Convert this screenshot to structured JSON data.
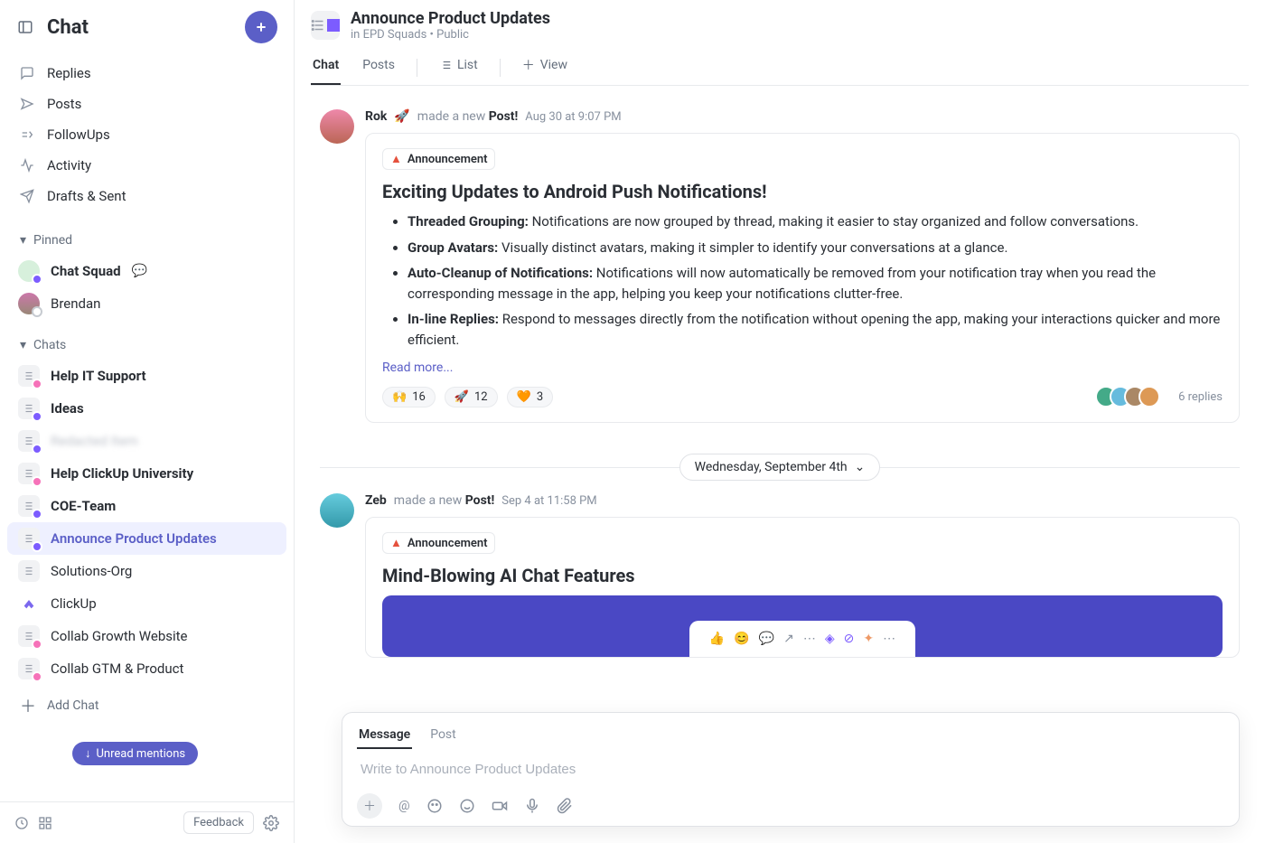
{
  "sidebar": {
    "title": "Chat",
    "nav": [
      {
        "label": "Replies"
      },
      {
        "label": "Posts"
      },
      {
        "label": "FollowUps"
      },
      {
        "label": "Activity"
      },
      {
        "label": "Drafts & Sent"
      }
    ],
    "pinned_header": "Pinned",
    "pinned": [
      {
        "label": "Chat Squad",
        "bold": true,
        "has_bubble": true
      },
      {
        "label": "Brendan"
      }
    ],
    "chats_header": "Chats",
    "chats": [
      {
        "label": "Help IT Support",
        "bold": true,
        "dot": "pink"
      },
      {
        "label": "Ideas",
        "bold": true,
        "dot": "purple"
      },
      {
        "label": "Redacted Item",
        "blur": true,
        "dot": "purple"
      },
      {
        "label": "Help ClickUp University",
        "bold": true,
        "dot": "pink"
      },
      {
        "label": "COE-Team",
        "bold": true,
        "dot": "purple"
      },
      {
        "label": "Announce Product Updates",
        "active": true,
        "dot": "purple"
      },
      {
        "label": "Solutions-Org",
        "dot": ""
      },
      {
        "label": "ClickUp",
        "clickup_logo": true
      },
      {
        "label": "Collab Growth Website",
        "dot": "pink"
      },
      {
        "label": "Collab GTM & Product",
        "dot": "pink"
      }
    ],
    "add_chat": "Add Chat",
    "unread_pill": "Unread mentions",
    "feedback": "Feedback"
  },
  "header": {
    "title": "Announce Product Updates",
    "location_prefix": "in ",
    "location": "EPD Squads",
    "visibility": "Public",
    "tabs": [
      {
        "label": "Chat",
        "active": true
      },
      {
        "label": "Posts"
      },
      {
        "label": "List",
        "icon": "list"
      },
      {
        "label": "View",
        "icon": "plus"
      }
    ]
  },
  "feed": {
    "post1": {
      "author": "Rok",
      "emoji": "🚀",
      "action": "made a new",
      "action_bold": "Post!",
      "timestamp": "Aug 30 at 9:07 PM",
      "badge": "Announcement",
      "title": "Exciting Updates to Android Push Notifications!",
      "bullets": [
        {
          "b": "Threaded Grouping:",
          "t": " Notifications are now grouped by thread, making it easier to stay organized and follow conversations."
        },
        {
          "b": "Group Avatars:",
          "t": " Visually distinct avatars, making it simpler to identify your conversations at a glance."
        },
        {
          "b": "Auto-Cleanup of Notifications:",
          "t": " Notifications will now automatically be removed from your notification tray when you read the corresponding message in the app, helping you keep your notifications clutter-free."
        },
        {
          "b": "In-line Replies:",
          "t": " Respond to messages directly from the notification without opening the app, making your interactions quicker and more efficient."
        }
      ],
      "read_more": "Read more...",
      "reactions": [
        {
          "emoji": "🙌",
          "count": "16"
        },
        {
          "emoji": "🚀",
          "count": "12"
        },
        {
          "emoji": "🧡",
          "count": "3"
        }
      ],
      "replies": "6 replies"
    },
    "separator_date": "Wednesday, September 4th",
    "post2": {
      "author": "Zeb",
      "action": "made a new",
      "action_bold": "Post!",
      "timestamp": "Sep 4 at 11:58 PM",
      "badge": "Announcement",
      "title": "Mind-Blowing AI Chat Features"
    }
  },
  "composer": {
    "tabs": [
      "Message",
      "Post"
    ],
    "placeholder": "Write to Announce Product Updates"
  }
}
